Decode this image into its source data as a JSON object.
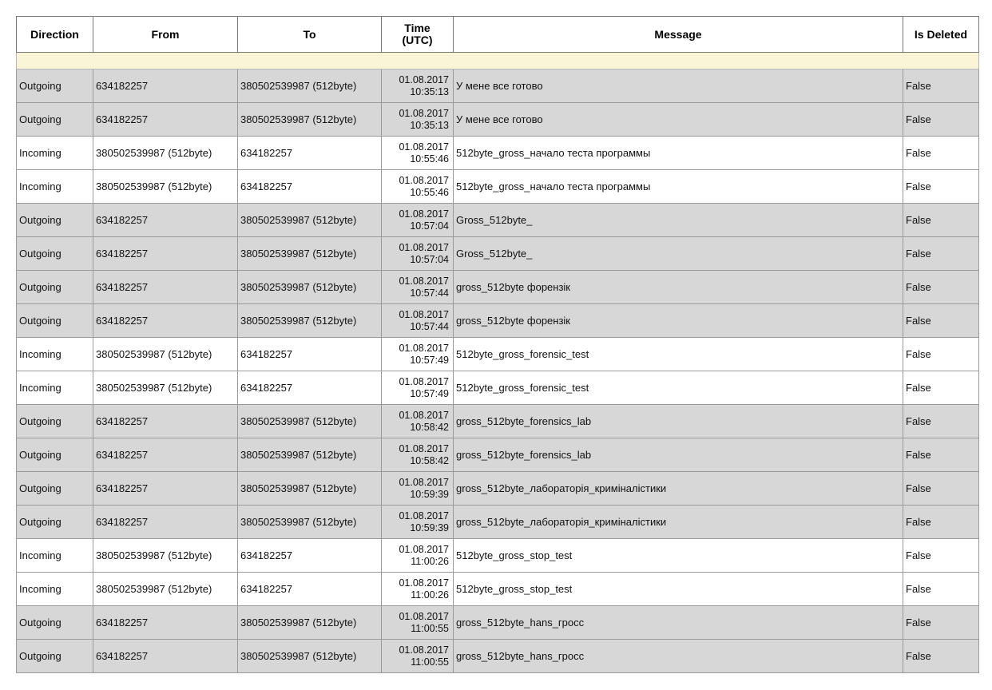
{
  "table": {
    "headers": {
      "direction": "Direction",
      "from": "From",
      "to": "To",
      "time_line1": "Time",
      "time_line2": "(UTC)",
      "message": "Message",
      "is_deleted": "Is Deleted"
    },
    "rows": [
      {
        "direction": "Outgoing",
        "from": "634182257",
        "to": "380502539987 (512byte)",
        "date": "01.08.2017",
        "time": "10:35:13",
        "message": "У мене все готово",
        "is_deleted": "False"
      },
      {
        "direction": "Outgoing",
        "from": "634182257",
        "to": "380502539987 (512byte)",
        "date": "01.08.2017",
        "time": "10:35:13",
        "message": "У мене все готово",
        "is_deleted": "False"
      },
      {
        "direction": "Incoming",
        "from": "380502539987 (512byte)",
        "to": "634182257",
        "date": "01.08.2017",
        "time": "10:55:46",
        "message": "512byte_gross_начало теста программы",
        "is_deleted": "False"
      },
      {
        "direction": "Incoming",
        "from": "380502539987 (512byte)",
        "to": "634182257",
        "date": "01.08.2017",
        "time": "10:55:46",
        "message": "512byte_gross_начало теста программы",
        "is_deleted": "False"
      },
      {
        "direction": "Outgoing",
        "from": "634182257",
        "to": "380502539987 (512byte)",
        "date": "01.08.2017",
        "time": "10:57:04",
        "message": "Gross_512byte_",
        "is_deleted": "False"
      },
      {
        "direction": "Outgoing",
        "from": "634182257",
        "to": "380502539987 (512byte)",
        "date": "01.08.2017",
        "time": "10:57:04",
        "message": "Gross_512byte_",
        "is_deleted": "False"
      },
      {
        "direction": "Outgoing",
        "from": "634182257",
        "to": "380502539987 (512byte)",
        "date": "01.08.2017",
        "time": "10:57:44",
        "message": "gross_512byte форензік",
        "is_deleted": "False"
      },
      {
        "direction": "Outgoing",
        "from": "634182257",
        "to": "380502539987 (512byte)",
        "date": "01.08.2017",
        "time": "10:57:44",
        "message": "gross_512byte форензік",
        "is_deleted": "False"
      },
      {
        "direction": "Incoming",
        "from": "380502539987 (512byte)",
        "to": "634182257",
        "date": "01.08.2017",
        "time": "10:57:49",
        "message": "512byte_gross_forensic_test",
        "is_deleted": "False"
      },
      {
        "direction": "Incoming",
        "from": "380502539987 (512byte)",
        "to": "634182257",
        "date": "01.08.2017",
        "time": "10:57:49",
        "message": "512byte_gross_forensic_test",
        "is_deleted": "False"
      },
      {
        "direction": "Outgoing",
        "from": "634182257",
        "to": "380502539987 (512byte)",
        "date": "01.08.2017",
        "time": "10:58:42",
        "message": "gross_512byte_forensics_lab",
        "is_deleted": "False"
      },
      {
        "direction": "Outgoing",
        "from": "634182257",
        "to": "380502539987 (512byte)",
        "date": "01.08.2017",
        "time": "10:58:42",
        "message": "gross_512byte_forensics_lab",
        "is_deleted": "False"
      },
      {
        "direction": "Outgoing",
        "from": "634182257",
        "to": "380502539987 (512byte)",
        "date": "01.08.2017",
        "time": "10:59:39",
        "message": "gross_512byte_лабораторія_криміналістики",
        "is_deleted": "False"
      },
      {
        "direction": "Outgoing",
        "from": "634182257",
        "to": "380502539987 (512byte)",
        "date": "01.08.2017",
        "time": "10:59:39",
        "message": "gross_512byte_лабораторія_криміналістики",
        "is_deleted": "False"
      },
      {
        "direction": "Incoming",
        "from": "380502539987 (512byte)",
        "to": "634182257",
        "date": "01.08.2017",
        "time": "11:00:26",
        "message": "512byte_gross_stop_test",
        "is_deleted": "False"
      },
      {
        "direction": "Incoming",
        "from": "380502539987 (512byte)",
        "to": "634182257",
        "date": "01.08.2017",
        "time": "11:00:26",
        "message": "512byte_gross_stop_test",
        "is_deleted": "False"
      },
      {
        "direction": "Outgoing",
        "from": "634182257",
        "to": "380502539987 (512byte)",
        "date": "01.08.2017",
        "time": "11:00:55",
        "message": "gross_512byte_hans_гросс",
        "is_deleted": "False"
      },
      {
        "direction": "Outgoing",
        "from": "634182257",
        "to": "380502539987 (512byte)",
        "date": "01.08.2017",
        "time": "11:00:55",
        "message": "gross_512byte_hans_гросс",
        "is_deleted": "False"
      }
    ]
  }
}
